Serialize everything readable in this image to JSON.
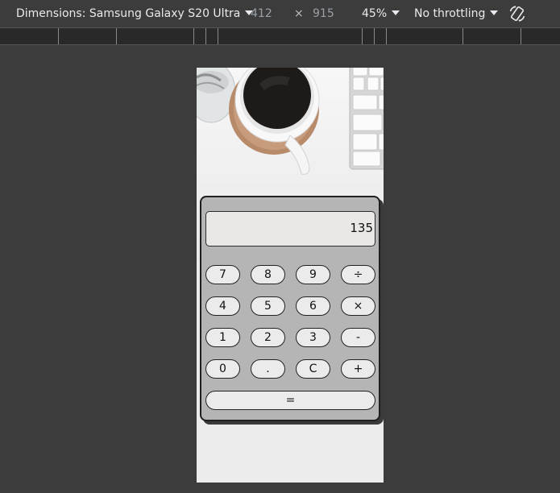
{
  "toolbar": {
    "dimensions_label": "Dimensions: Samsung Galaxy S20 Ultra",
    "width": "412",
    "times": "×",
    "height": "915",
    "zoom": "45%",
    "throttling": "No throttling"
  },
  "calculator": {
    "display": "135",
    "rows": [
      [
        "7",
        "8",
        "9",
        "÷"
      ],
      [
        "4",
        "5",
        "6",
        "×"
      ],
      [
        "1",
        "2",
        "3",
        "-"
      ],
      [
        "0",
        ".",
        "C",
        "+"
      ]
    ],
    "equals": "="
  },
  "colors": {
    "devtools_bg": "#3c3c3c",
    "calculator_body": "#b5b5b5",
    "display_bg": "#e9e8e6",
    "key_bg": "#ebebeb"
  }
}
